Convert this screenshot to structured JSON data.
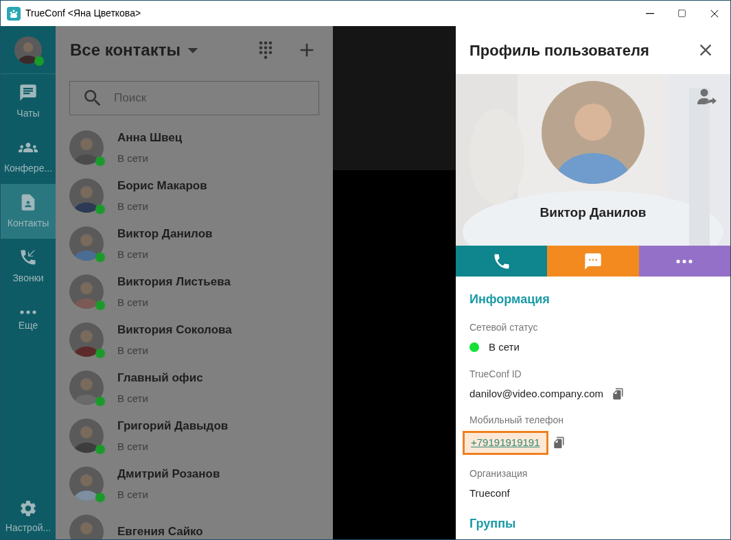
{
  "window": {
    "title": "TrueConf <Яна Цветкова>"
  },
  "sidebar": {
    "user_online": true,
    "items": [
      {
        "kind": "chats",
        "label": "Чаты",
        "selected": false
      },
      {
        "kind": "conferences",
        "label": "Конфере...",
        "selected": false
      },
      {
        "kind": "contacts",
        "label": "Контакты",
        "selected": true
      },
      {
        "kind": "calls",
        "label": "Звонки",
        "selected": false
      },
      {
        "kind": "more",
        "label": "Еще",
        "selected": false
      }
    ],
    "settings": {
      "label": "Настрой..."
    }
  },
  "contacts": {
    "title": "Все контакты",
    "search": {
      "placeholder": "Поиск"
    },
    "list": [
      {
        "name": "Анна Швец",
        "status": "В сети",
        "online": true
      },
      {
        "name": "Борис Макаров",
        "status": "В сети",
        "online": true
      },
      {
        "name": "Виктор Данилов",
        "status": "В сети",
        "online": true
      },
      {
        "name": "Виктория Листьева",
        "status": "В сети",
        "online": true
      },
      {
        "name": "Виктория Соколова",
        "status": "В сети",
        "online": true
      },
      {
        "name": "Главный офис",
        "status": "В сети",
        "online": true
      },
      {
        "name": "Григорий Давыдов",
        "status": "В сети",
        "online": true
      },
      {
        "name": "Дмитрий Розанов",
        "status": "В сети",
        "online": true
      },
      {
        "name": "Евгения Сайко"
      }
    ]
  },
  "profile": {
    "title": "Профиль пользователя",
    "name": "Виктор Данилов",
    "actions": [
      {
        "kind": "call",
        "color": "#0f858d"
      },
      {
        "kind": "chat",
        "color": "#f28a1f"
      },
      {
        "kind": "more",
        "color": "#9570c8"
      }
    ],
    "info_heading": "Информация",
    "fields": [
      {
        "kind": "status",
        "label": "Сетевой статус",
        "value": "В сети",
        "online": true
      },
      {
        "kind": "copy",
        "label": "TrueConf ID",
        "value": "danilov@video.company.com"
      },
      {
        "kind": "phone",
        "label": "Мобильный телефон",
        "value": "+79191919191",
        "highlighted": true
      },
      {
        "kind": "plain",
        "label": "Организация",
        "value": "Trueconf"
      }
    ],
    "groups_heading": "Группы"
  }
}
